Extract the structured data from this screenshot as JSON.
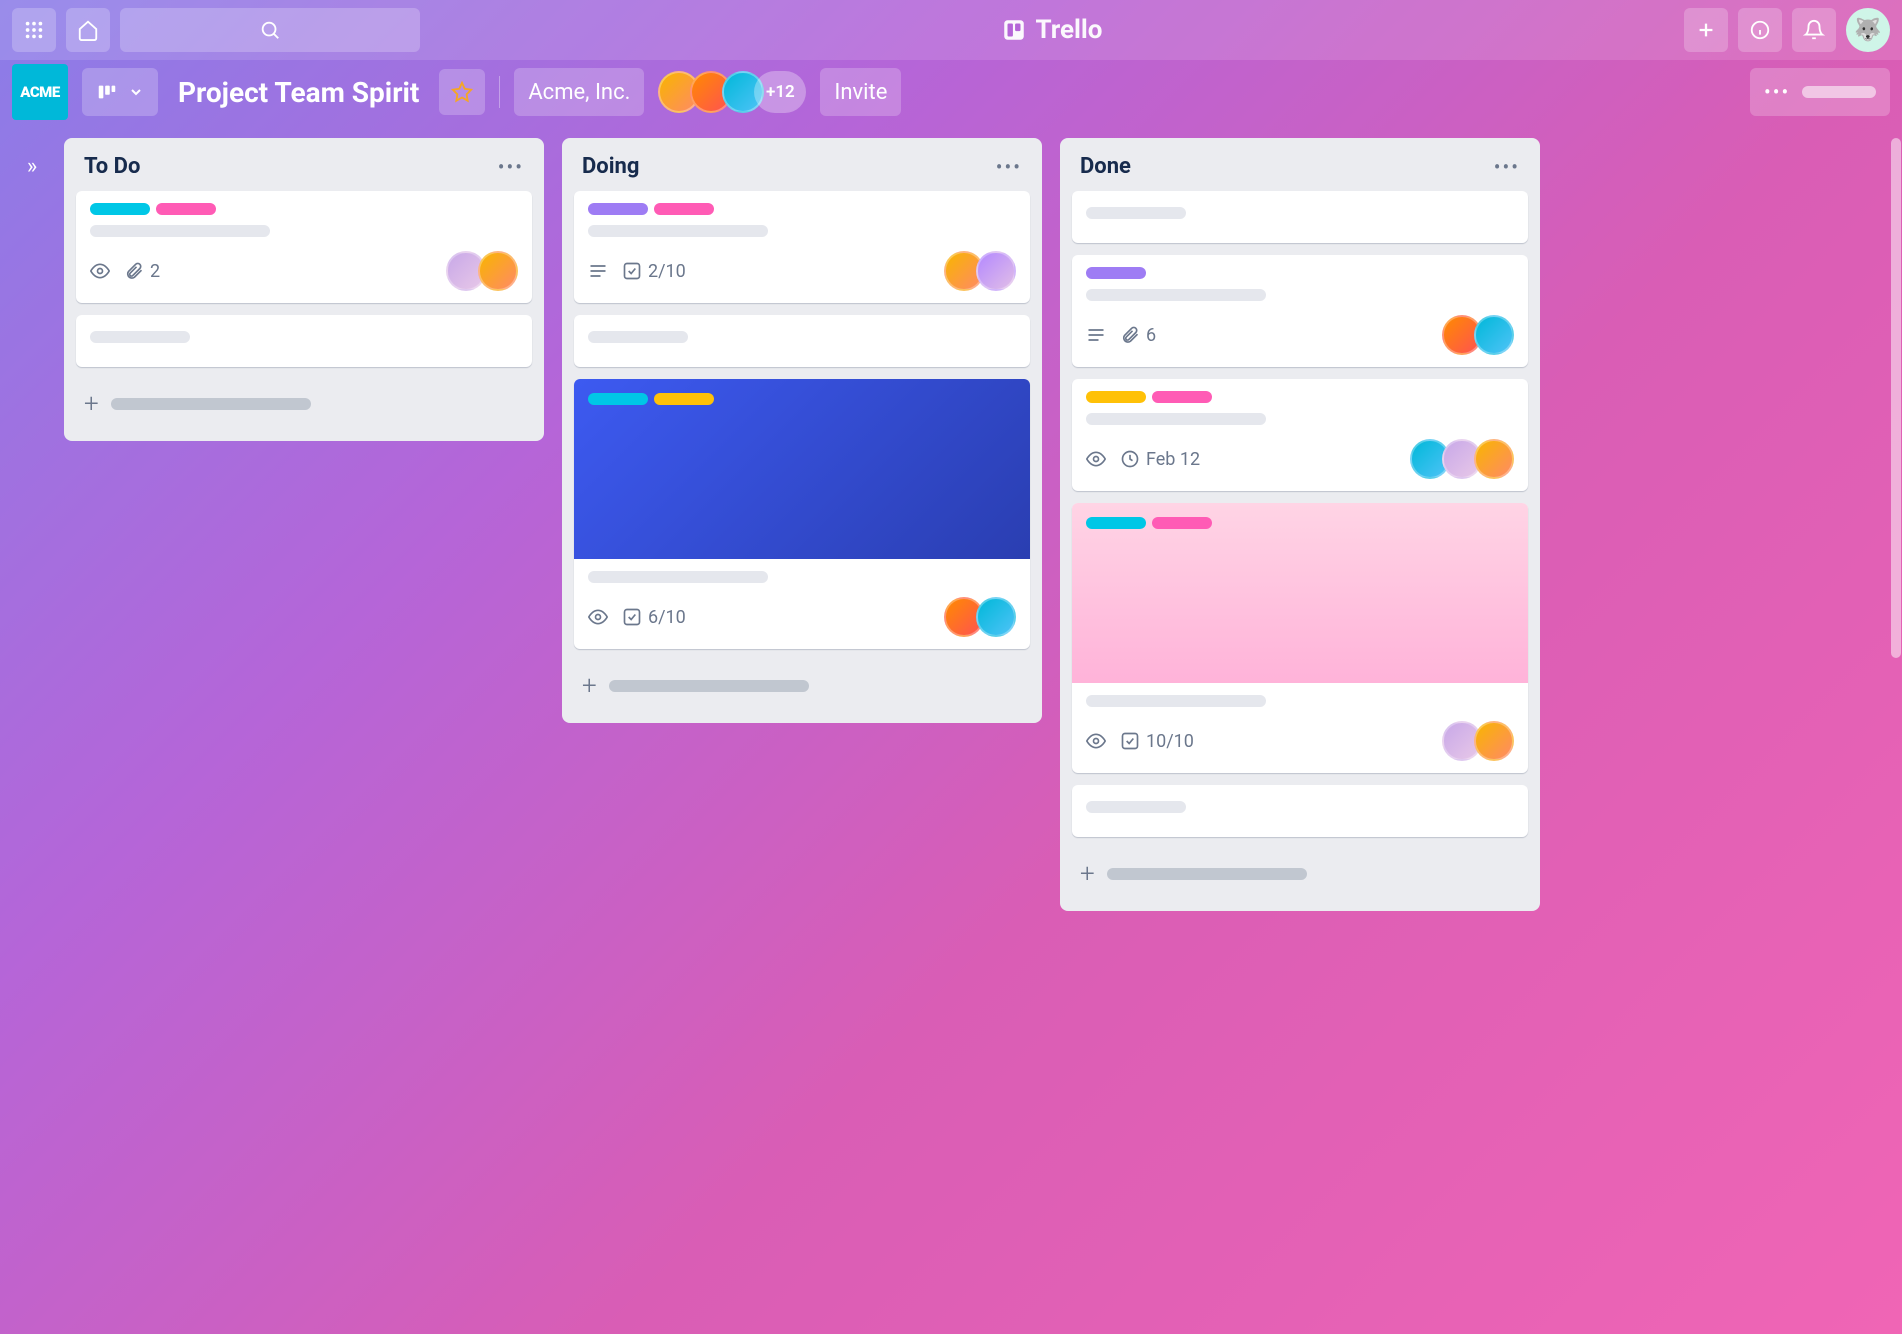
{
  "app_name": "Trello",
  "board": {
    "title": "Project Team Spirit",
    "workspace_badge": "ACME",
    "team_name": "Acme, Inc.",
    "extra_members": "+12",
    "invite_label": "Invite"
  },
  "lists": [
    {
      "title": "To Do",
      "cards": [
        {
          "labels": [
            "cyan",
            "pink"
          ],
          "badges": {
            "watch": true,
            "attachments": "2"
          },
          "members": 2
        },
        {
          "simple": true
        }
      ]
    },
    {
      "title": "Doing",
      "cards": [
        {
          "labels": [
            "purple",
            "pink"
          ],
          "badges": {
            "desc": true,
            "checklist": "2/10"
          },
          "members": 2
        },
        {
          "simple": true
        },
        {
          "cover": "blue",
          "cover_labels": [
            "cyan",
            "yellow"
          ],
          "badges": {
            "watch": true,
            "checklist": "6/10"
          },
          "members": 2
        }
      ]
    },
    {
      "title": "Done",
      "cards": [
        {
          "simple": true
        },
        {
          "labels": [
            "purple"
          ],
          "badges": {
            "desc": true,
            "attachments": "6"
          },
          "members": 2
        },
        {
          "labels": [
            "yellow",
            "pink"
          ],
          "badges": {
            "watch": true,
            "due": "Feb 12"
          },
          "members": 3
        },
        {
          "cover": "pink",
          "cover_labels": [
            "cyan",
            "pink"
          ],
          "badges": {
            "watch": true,
            "checklist": "10/10"
          },
          "members": 2
        },
        {
          "simple": true
        }
      ]
    }
  ]
}
